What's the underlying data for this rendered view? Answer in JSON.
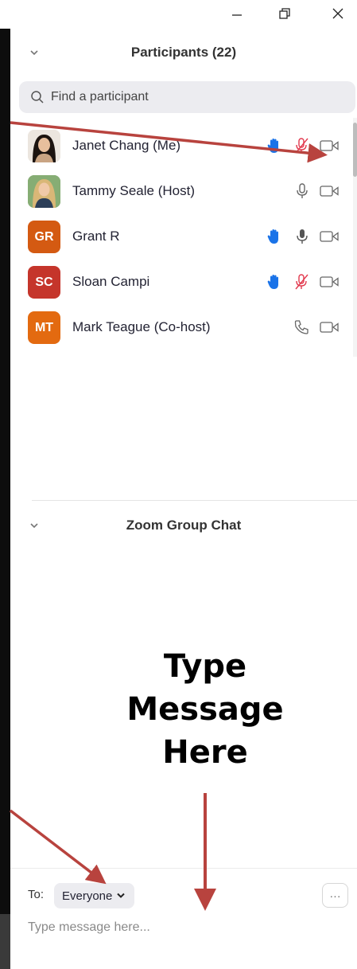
{
  "window": {
    "minimize_icon": "minimize-icon",
    "restore_icon": "restore-icon",
    "close_icon": "close-icon"
  },
  "participants": {
    "title": "Participants (22)",
    "search_placeholder": "Find a participant",
    "list": [
      {
        "name": "Janet Chang (Me)",
        "avatar_type": "photo",
        "hand_raised": true,
        "mic": "muted",
        "video": "off"
      },
      {
        "name": "Tammy Seale (Host)",
        "avatar_type": "photo",
        "hand_raised": false,
        "mic": "on",
        "video": "off"
      },
      {
        "name": "Grant R",
        "avatar_type": "initials",
        "initials": "GR",
        "avatar_color": "#d45a12",
        "hand_raised": true,
        "mic": "on",
        "video": "off"
      },
      {
        "name": "Sloan Campi",
        "avatar_type": "initials",
        "initials": "SC",
        "avatar_color": "#c5352b",
        "hand_raised": true,
        "mic": "muted",
        "video": "off"
      },
      {
        "name": "Mark Teague (Co-host)",
        "avatar_type": "initials",
        "initials": "MT",
        "avatar_color": "#e36a10",
        "hand_raised": false,
        "mic": "phone",
        "video": "off"
      }
    ]
  },
  "chat": {
    "title": "Zoom Group Chat",
    "to_label": "To:",
    "recipient": "Everyone",
    "more_label": "···",
    "message_placeholder": "Type message here..."
  },
  "annotation": {
    "line1": "Type",
    "line2": "Message",
    "line3": "Here",
    "arrow_color": "#b8433e"
  },
  "colors": {
    "hand": "#1a73e8",
    "muted": "#e2384d",
    "icon_gray": "#666666"
  }
}
